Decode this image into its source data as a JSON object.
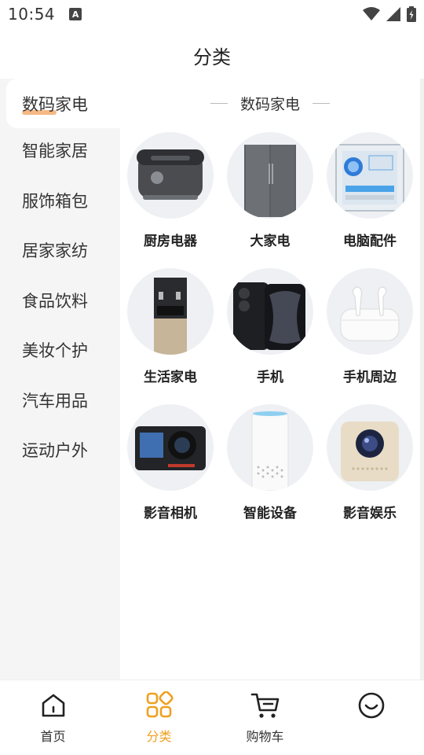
{
  "status_bar": {
    "time": "10:54",
    "notification_badge": "A",
    "icons": [
      "wifi-icon",
      "signal-icon",
      "battery-icon"
    ]
  },
  "header": {
    "title": "分类"
  },
  "sidebar": {
    "active_index": 0,
    "items": [
      {
        "label": "数码家电"
      },
      {
        "label": "智能家居"
      },
      {
        "label": "服饰箱包"
      },
      {
        "label": "居家家纺"
      },
      {
        "label": "食品饮料"
      },
      {
        "label": "美妆个护"
      },
      {
        "label": "汽车用品"
      },
      {
        "label": "运动户外"
      }
    ]
  },
  "content": {
    "section_title": "数码家电",
    "items": [
      {
        "label": "厨房电器",
        "icon": "rice-cooker-icon"
      },
      {
        "label": "大家电",
        "icon": "refrigerator-icon"
      },
      {
        "label": "电脑配件",
        "icon": "pc-case-icon"
      },
      {
        "label": "生活家电",
        "icon": "water-dispenser-icon"
      },
      {
        "label": "手机",
        "icon": "phone-icon"
      },
      {
        "label": "手机周边",
        "icon": "earbuds-icon"
      },
      {
        "label": "影音相机",
        "icon": "action-camera-icon"
      },
      {
        "label": "智能设备",
        "icon": "smart-speaker-icon"
      },
      {
        "label": "影音娱乐",
        "icon": "projector-icon"
      }
    ]
  },
  "bottom_nav": {
    "active_index": 1,
    "items": [
      {
        "label": "首页",
        "icon": "home-icon"
      },
      {
        "label": "分类",
        "icon": "category-grid-icon"
      },
      {
        "label": "购物车",
        "icon": "cart-icon"
      },
      {
        "label": "",
        "icon": "profile-smile-icon"
      }
    ]
  },
  "colors": {
    "accent": "#f0a020",
    "sidebar_bg": "#f5f5f5",
    "highlight": "#f2a25b",
    "thumb_bg": "#eef0f3"
  }
}
